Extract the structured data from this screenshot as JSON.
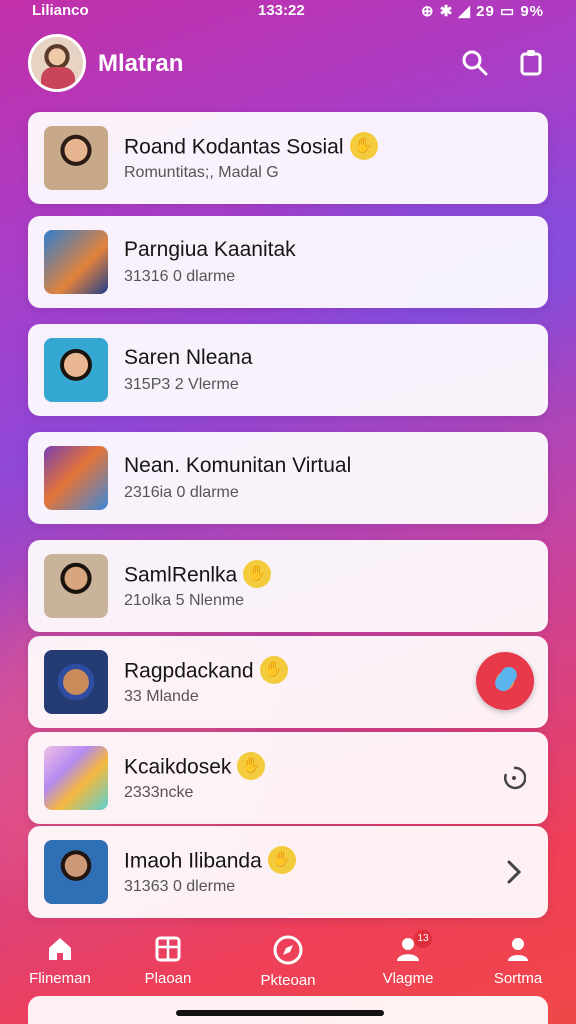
{
  "status_bar": {
    "carrier": "Lilianco",
    "time": "133:22",
    "right_text": "⊕ ✱ ◢ 29 ▭ 9%"
  },
  "header": {
    "title": "Mlatran"
  },
  "items": [
    {
      "title": "Roand Kodantas Sosial",
      "subtitle": "Romuntitas;, Madal G",
      "badge": true,
      "trailing": "none",
      "thumb": "person"
    },
    {
      "title": "Parngiua Kaanitak",
      "subtitle": "31316 0 dlarme",
      "badge": false,
      "trailing": "none",
      "thumb": "group"
    },
    {
      "title": "Saren Nleana",
      "subtitle": "315P3 2 Vlerme",
      "badge": false,
      "trailing": "none",
      "thumb": "person-blue"
    },
    {
      "title": "Nean. Komunitan Virtual",
      "subtitle": "2316ia 0 dlarme",
      "badge": false,
      "trailing": "none",
      "thumb": "cartoon"
    },
    {
      "title": "SamlRenlka",
      "subtitle": "21olka 5 Nlenme",
      "badge": true,
      "trailing": "none",
      "thumb": "person-dark"
    },
    {
      "title": "Ragpdackand",
      "subtitle": "33 Mlande",
      "badge": true,
      "trailing": "fab",
      "thumb": "device"
    },
    {
      "title": "Kcaikdosek",
      "subtitle": "2333ncke",
      "badge": true,
      "trailing": "spinner",
      "thumb": "box"
    },
    {
      "title": "Imaoh Ilibanda",
      "subtitle": "31363 0 dlerme",
      "badge": true,
      "trailing": "chevron",
      "thumb": "person-glasses"
    }
  ],
  "nav": [
    {
      "label": "Flineman",
      "icon": "home-icon"
    },
    {
      "label": "Plaoan",
      "icon": "grid-icon"
    },
    {
      "label": "Pkteoan",
      "icon": "compass-icon"
    },
    {
      "label": "Vlagme",
      "icon": "people-icon",
      "badge": "13"
    },
    {
      "label": "Sortma",
      "icon": "profile-icon"
    }
  ]
}
